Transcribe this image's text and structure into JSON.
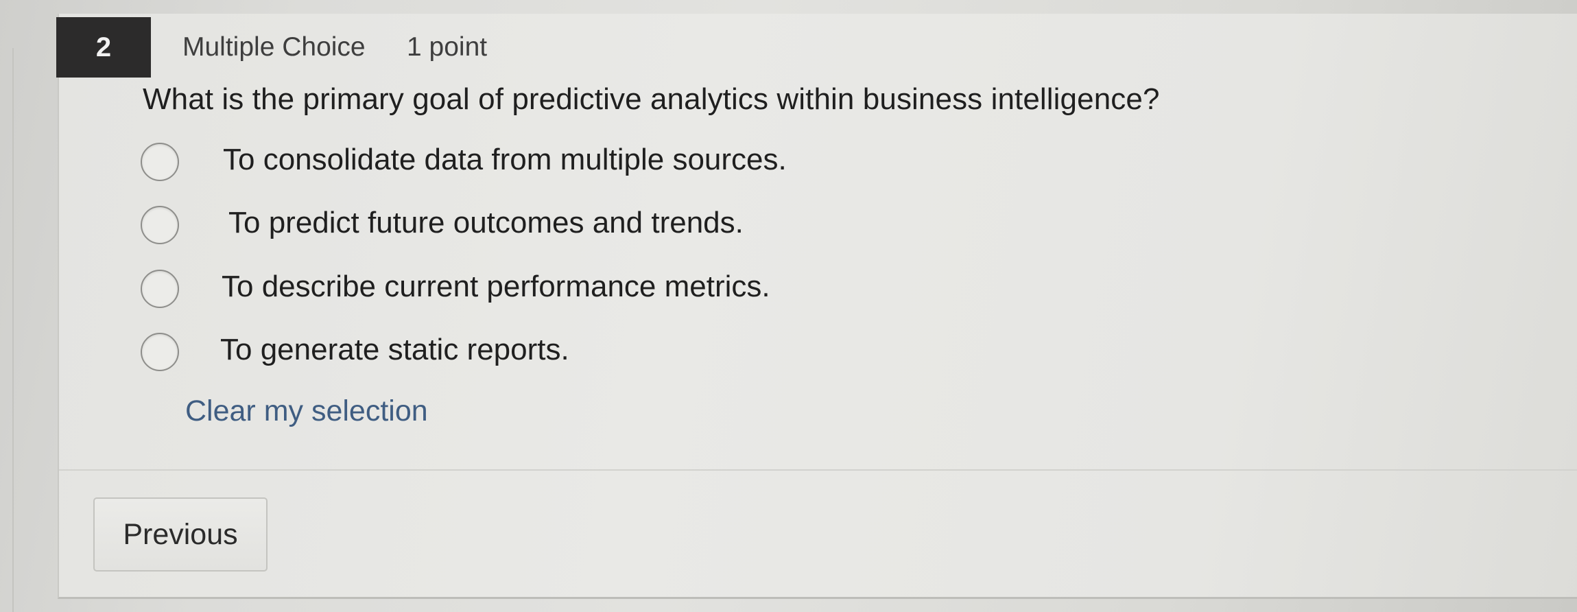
{
  "question": {
    "number": "2",
    "type": "Multiple Choice",
    "points": "1 point",
    "text": "What is the primary goal of predictive analytics within business intelligence?",
    "options": [
      {
        "label": "To consolidate data from multiple sources.",
        "selected": false
      },
      {
        "label": "To predict future outcomes and trends.",
        "selected": false
      },
      {
        "label": "To describe current performance metrics.",
        "selected": false
      },
      {
        "label": "To generate static reports.",
        "selected": false
      }
    ],
    "clear_label": "Clear my selection"
  },
  "navigation": {
    "previous_label": "Previous"
  }
}
